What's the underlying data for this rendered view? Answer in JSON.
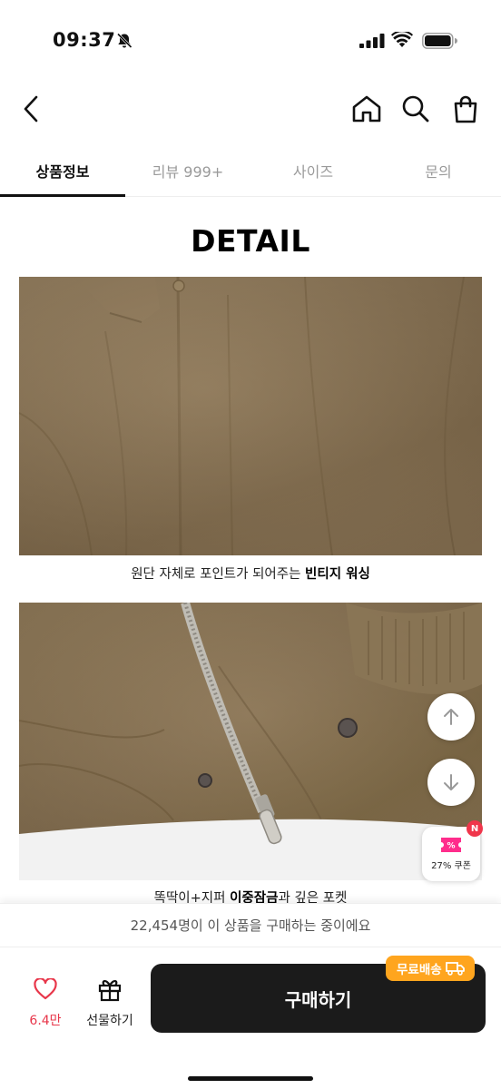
{
  "status_bar": {
    "time": "09:37",
    "icons": [
      "bell-slash-icon",
      "signal-icon",
      "wifi-icon",
      "battery-icon"
    ]
  },
  "header": {
    "icons": [
      "back-arrow-icon",
      "home-icon",
      "search-icon",
      "shopping-bag-icon"
    ]
  },
  "tabs": [
    {
      "label": "상품정보",
      "active": true
    },
    {
      "label": "리뷰 999+",
      "active": false
    },
    {
      "label": "사이즈",
      "active": false
    },
    {
      "label": "문의",
      "active": false
    }
  ],
  "content": {
    "title": "DETAIL",
    "captions": [
      {
        "text": "원단 자체로 포인트가 되어주는 ",
        "bold": "빈티지 워싱",
        "after": ""
      },
      {
        "text": "똑딱이+지퍼 ",
        "bold": "이중잠금",
        "after": "과 깊은 포켓"
      }
    ]
  },
  "floating": {
    "coupon_label": "27% 쿠폰",
    "coupon_badge": "N",
    "icons": [
      "arrow-up-icon",
      "arrow-down-icon",
      "coupon-ticket-icon"
    ]
  },
  "bottom": {
    "purchase_banner": "22,454명이 이 상품을 구매하는 중이에요",
    "like_count": "6.4만",
    "gift_label": "선물하기",
    "buy_label": "구매하기",
    "free_shipping": "무료배송"
  },
  "colors": {
    "accent_red": "#e8364a",
    "buy_button": "#1b1b1b",
    "free_shipping_badge": "#ffa51e",
    "fabric": "#836e51"
  }
}
